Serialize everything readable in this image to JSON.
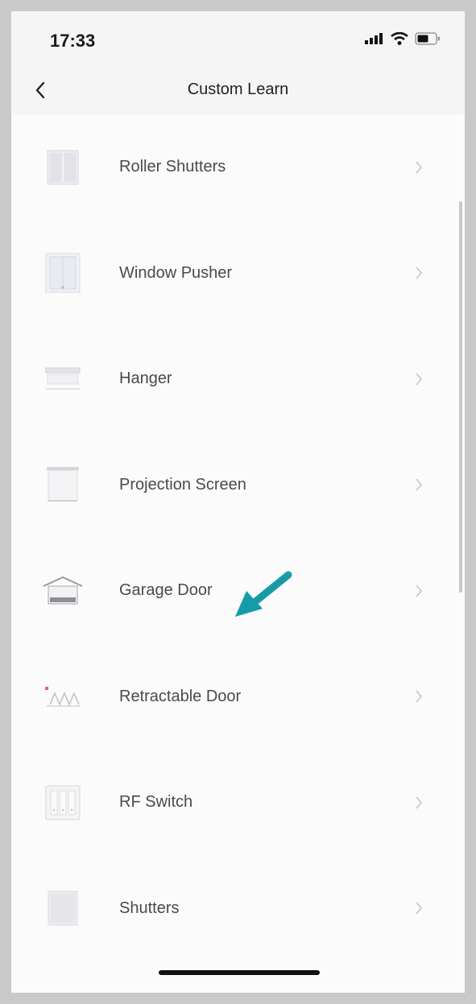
{
  "status_bar": {
    "time": "17:33",
    "icons": [
      "signal-icon",
      "wifi-icon",
      "battery-icon"
    ]
  },
  "nav": {
    "title": "Custom Learn",
    "back_icon": "chevron-left-icon"
  },
  "items": [
    {
      "label": "Roller Shutters",
      "icon": "roller-shutter-icon"
    },
    {
      "label": "Window Pusher",
      "icon": "window-pusher-icon"
    },
    {
      "label": "Hanger",
      "icon": "hanger-icon"
    },
    {
      "label": "Projection Screen",
      "icon": "projection-screen-icon"
    },
    {
      "label": "Garage Door",
      "icon": "garage-door-icon"
    },
    {
      "label": "Retractable Door",
      "icon": "retractable-door-icon"
    },
    {
      "label": "RF Switch",
      "icon": "rf-switch-icon"
    },
    {
      "label": "Shutters",
      "icon": "shutters-icon"
    }
  ],
  "annotation": {
    "arrow_color": "#169ca6",
    "points_to": "Garage Door"
  }
}
